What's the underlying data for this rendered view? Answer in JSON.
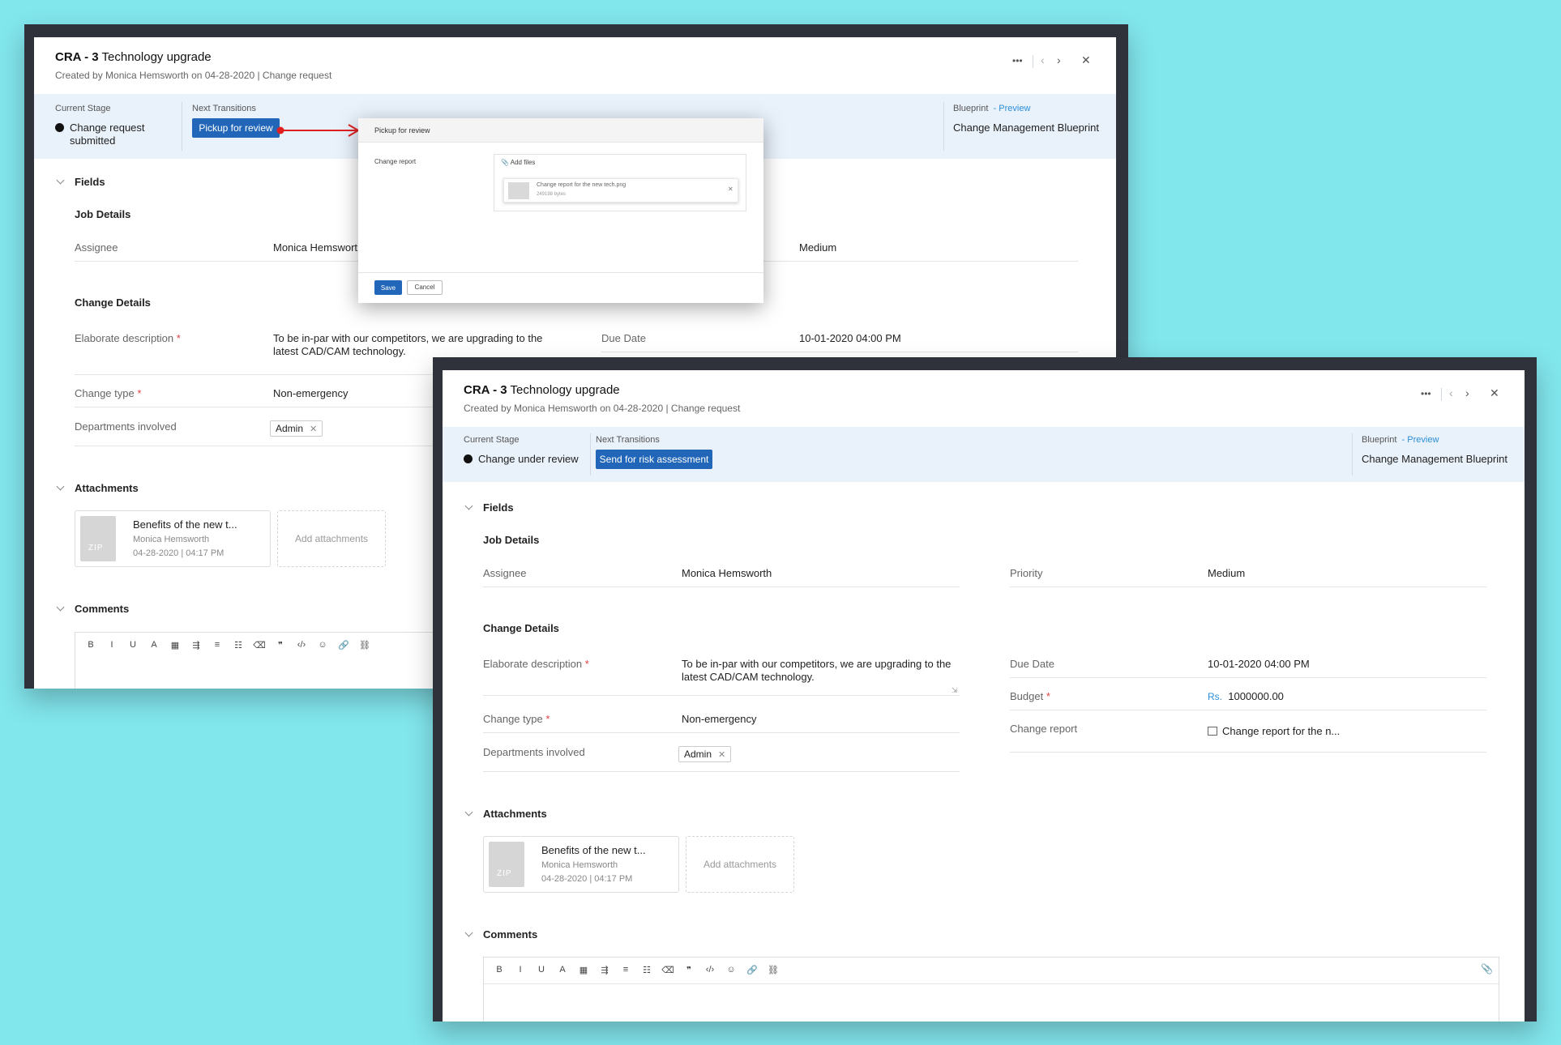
{
  "window1": {
    "title_id": "CRA - 3",
    "title_text": "Technology upgrade",
    "subtitle": "Created by  Monica Hemsworth  on 04-28-2020 | Change request",
    "current_stage_label": "Current Stage",
    "current_stage_line1": "Change request",
    "current_stage_line2": "submitted",
    "next_transitions_label": "Next Transitions",
    "transition_button": "Pickup for review",
    "blueprint_label": "Blueprint",
    "blueprint_preview": "- Preview",
    "blueprint_name": "Change Management Blueprint",
    "fields_section": "Fields",
    "job_details": "Job Details",
    "assignee_label": "Assignee",
    "assignee_value": "Monica Hemswort",
    "priority_value": "Medium",
    "change_details": "Change Details",
    "elab_label": "Elaborate description",
    "elab_line1": "To be in-par with our competitors, we are upgrading to the",
    "elab_line2": "latest CAD/CAM technology.",
    "due_label": "Due Date",
    "due_value": "10-01-2020 04:00 PM",
    "change_type_label": "Change type",
    "change_type_value": "Non-emergency",
    "dept_label": "Departments involved",
    "dept_tag": "Admin",
    "attachments_section": "Attachments",
    "att_name": "Benefits of the new t...",
    "att_author": "Monica Hemsworth",
    "att_date": "04-28-2020 | 04:17 PM",
    "zip_label": "ZIP",
    "add_attachments": "Add attachments",
    "comments_section": "Comments",
    "more_icon": "•••"
  },
  "modal": {
    "title": "Pickup for review",
    "field_label": "Change report",
    "add_files": "Add files",
    "file_name": "Change report for the new tech.png",
    "file_size": "249198 bytes",
    "save": "Save",
    "cancel": "Cancel"
  },
  "window2": {
    "title_id": "CRA - 3",
    "title_text": "Technology upgrade",
    "subtitle": "Created by  Monica Hemsworth  on 04-28-2020 | Change request",
    "current_stage_label": "Current Stage",
    "current_stage": "Change under review",
    "next_transitions_label": "Next Transitions",
    "transition_button": "Send for risk assessment",
    "blueprint_label": "Blueprint",
    "blueprint_preview": "- Preview",
    "blueprint_name": "Change Management Blueprint",
    "fields_section": "Fields",
    "job_details": "Job Details",
    "assignee_label": "Assignee",
    "assignee_value": "Monica Hemsworth",
    "priority_label": "Priority",
    "priority_value": "Medium",
    "change_details": "Change Details",
    "elab_label": "Elaborate description",
    "elab_line1": "To be in-par with our competitors, we are upgrading to the",
    "elab_line2": "latest CAD/CAM technology.",
    "due_label": "Due Date",
    "due_value": "10-01-2020 04:00 PM",
    "budget_label": "Budget",
    "budget_currency": "Rs.",
    "budget_value": "1000000.00",
    "change_type_label": "Change type",
    "change_type_value": "Non-emergency",
    "change_report_label": "Change report",
    "change_report_value": "Change report for the n...",
    "dept_label": "Departments involved",
    "dept_tag": "Admin",
    "attachments_section": "Attachments",
    "att_name": "Benefits of the new t...",
    "att_author": "Monica Hemsworth",
    "att_date": "04-28-2020 | 04:17 PM",
    "zip_label": "ZIP",
    "add_attachments": "Add attachments",
    "comments_section": "Comments",
    "more_icon": "•••"
  },
  "toolbar": [
    "B",
    "I",
    "U",
    "A",
    "▦",
    "⇶",
    "≡",
    "☷",
    "⌫",
    "❞",
    "‹/›",
    "☺",
    "🔗",
    "⛓"
  ],
  "colors": {
    "background": "#82e6ed",
    "frame": "#2f323a",
    "accent": "#2166b8",
    "strip": "#e9f1fb",
    "arrow": "#e02020",
    "link": "#2a8fd6"
  }
}
